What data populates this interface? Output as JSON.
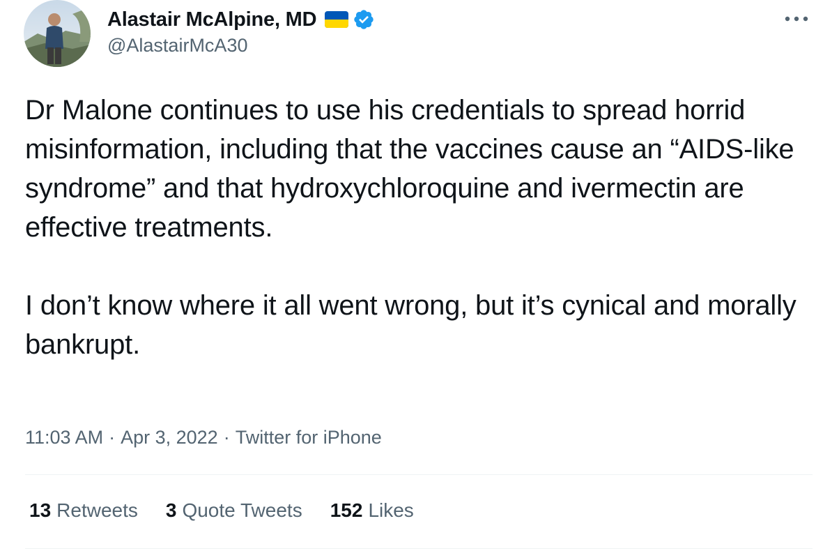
{
  "author": {
    "display_name": "Alastair McAlpine, MD",
    "handle": "@AlastairMcA30",
    "flag_icon": "ukraine-flag-icon",
    "verified_icon": "verified-badge-icon",
    "verified_color": "#1d9bf0"
  },
  "tweet": {
    "paragraphs": [
      "Dr Malone continues to use his credentials to spread horrid misinformation, including that the vaccines cause an “AIDS-like syndrome” and that hydroxychloroquine and ivermectin are effective treatments.",
      "I don’t know where it all went wrong, but it’s cynical and morally bankrupt."
    ],
    "time": "11:03 AM",
    "date": "Apr 3, 2022",
    "source": "Twitter for iPhone",
    "separator": "·"
  },
  "stats": {
    "retweets": {
      "count": "13",
      "label": "Retweets"
    },
    "quote_tweets": {
      "count": "3",
      "label": "Quote Tweets"
    },
    "likes": {
      "count": "152",
      "label": "Likes"
    }
  },
  "colors": {
    "text": "#0f1419",
    "secondary_text": "#536471",
    "divider": "#eff3f4",
    "flag_blue": "#0057b7",
    "flag_yellow": "#ffd700"
  }
}
